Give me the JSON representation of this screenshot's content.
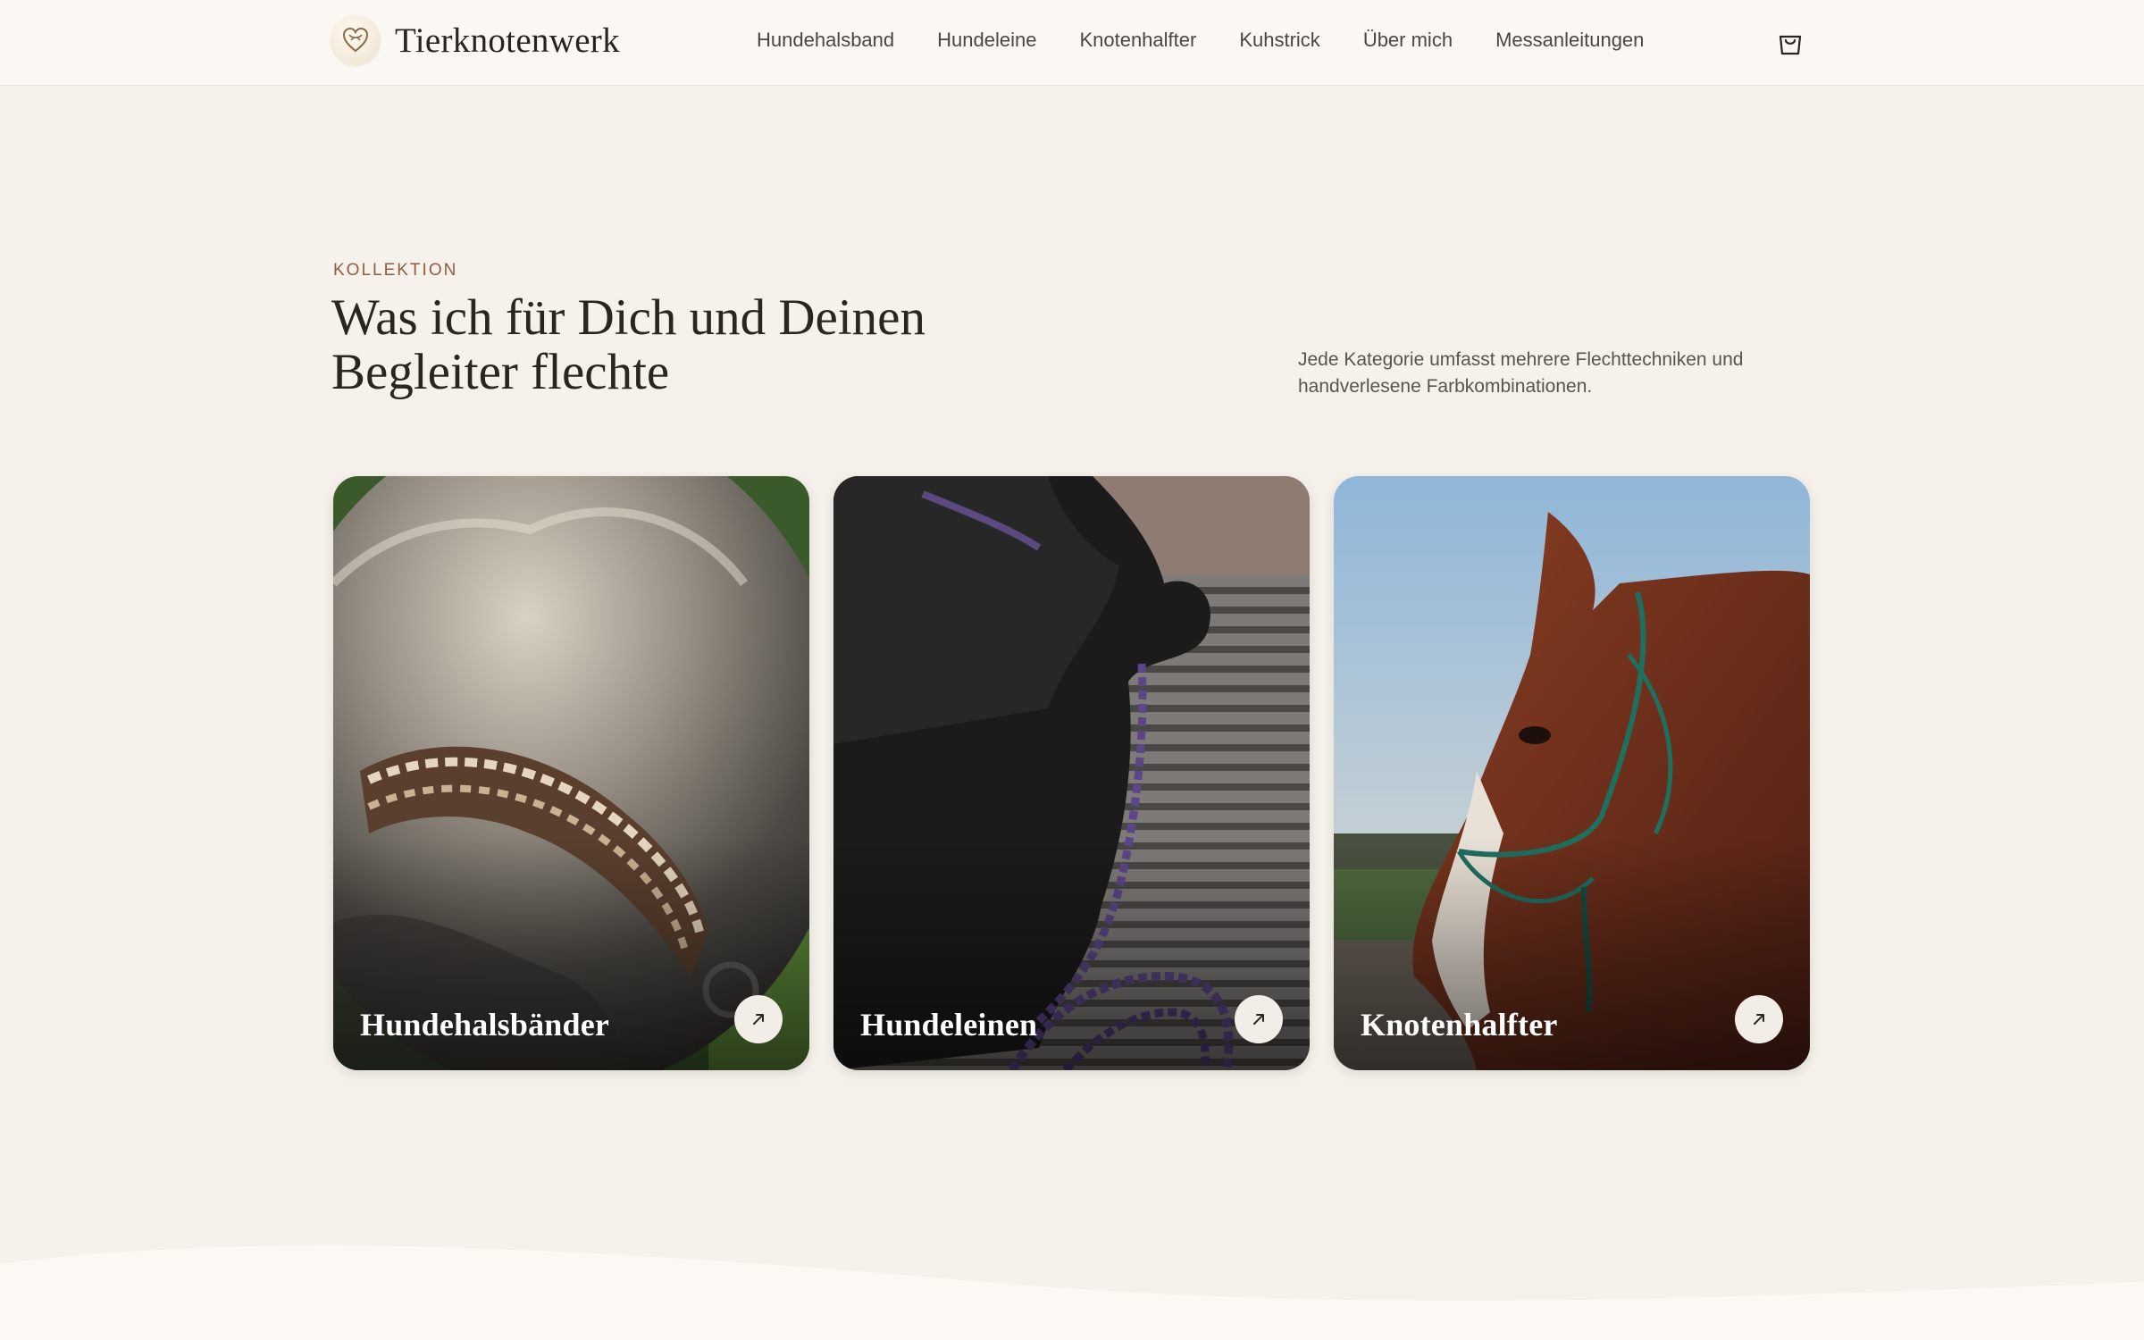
{
  "header": {
    "brand": "Tierknotenwerk",
    "logo_icon": "heart-knot-logo",
    "nav": [
      {
        "label": "Hundehalsband"
      },
      {
        "label": "Hundeleine"
      },
      {
        "label": "Knotenhalfter"
      },
      {
        "label": "Kuhstrick"
      },
      {
        "label": "Über mich"
      },
      {
        "label": "Messanleitungen"
      }
    ],
    "cart_icon": "shopping-bag-icon"
  },
  "collection": {
    "eyebrow": "KOLLEKTION",
    "headline": "Was ich für Dich und Deinen Begleiter flechte",
    "intro": "Jede Kategorie umfasst mehrere Flechttechniken und handverlesene Farbkombinationen.",
    "cards": [
      {
        "title": "Hundehalsbänder",
        "image": "dog wearing braided collar",
        "icon": "arrow-up-right-icon"
      },
      {
        "title": "Hundeleinen",
        "image": "black dog with purple braided leash",
        "icon": "arrow-up-right-icon"
      },
      {
        "title": "Knotenhalfter",
        "image": "horse wearing green rope halter",
        "icon": "arrow-up-right-icon"
      }
    ]
  },
  "colors": {
    "background": "#f6f2eb",
    "header": "#fbf8f3",
    "accent": "#8c5f45",
    "text": "#2b2520"
  }
}
